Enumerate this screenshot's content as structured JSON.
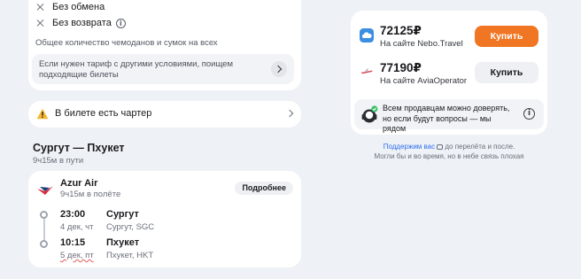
{
  "tariff": {
    "conditions": [
      "Без обмена",
      "Без возврата"
    ],
    "bags_note": "Общее количество чемоданов и сумок на всех",
    "other_tariff": "Если нужен тариф с другими условиями, поищем подходящие билеты"
  },
  "charter": {
    "label": "В билете есть чартер"
  },
  "route": {
    "title": "Сургут — Пхукет",
    "duration": "9ч15м в пути"
  },
  "flight": {
    "airline": "Azur Air",
    "flight_time": "9ч15м в полёте",
    "details_label": "Подробнее",
    "departure": {
      "time": "23:00",
      "date": "4 дек, чт",
      "city": "Сургут",
      "airport": "Сургут, SGC"
    },
    "arrival": {
      "time": "10:15",
      "date": "5 дек, пт",
      "city": "Пхукет",
      "airport": "Пхукет, HKT"
    }
  },
  "offers": [
    {
      "price": "72125₽",
      "site": "На сайте Nebo.Travel",
      "buy_label": "Купить",
      "logo_icon": "cloud-icon",
      "logo_color": "#3b8fe0"
    },
    {
      "price": "77190₽",
      "site": "На сайте AviaOperator",
      "buy_label": "Купить",
      "logo_icon": "plane-icon",
      "logo_color": "#d8434e"
    }
  ],
  "trust": {
    "text": "Всем продавцам можно доверять, но если будут вопросы — мы рядом"
  },
  "support": {
    "link": "Поддержим вас",
    "text_after_link": " до перелёта и после.",
    "line2": "Могли бы и во время, но в небе связь плохая"
  },
  "colors": {
    "accent": "#f07623",
    "link": "#2f6ff0",
    "background": "#eef1f5"
  }
}
